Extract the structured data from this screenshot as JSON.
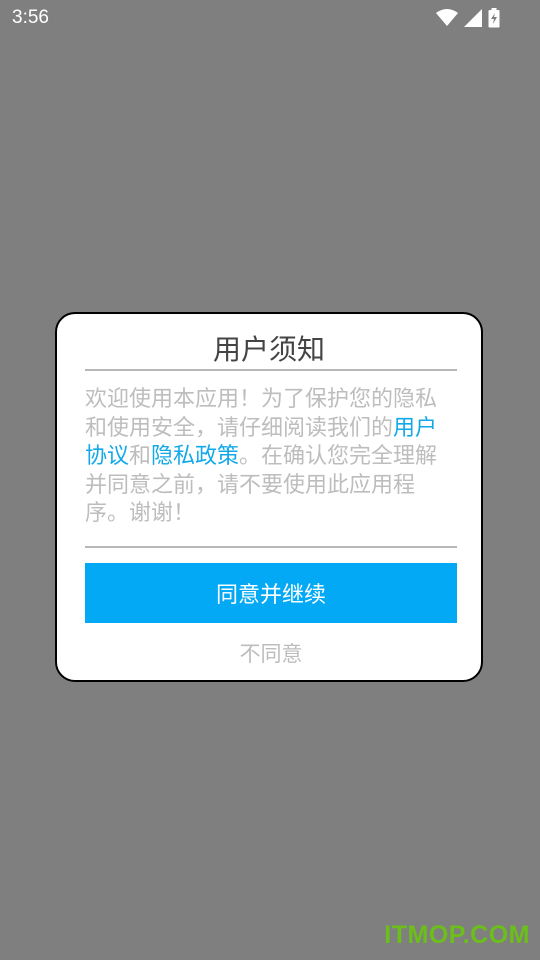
{
  "status_bar": {
    "time": "3:56",
    "icons": [
      "wifi-icon",
      "cell-signal-icon",
      "battery-charging-icon"
    ]
  },
  "dialog": {
    "title": "用户须知",
    "message": {
      "part1": "欢迎使用本应用！为了保护您的隐私和使用安全，请仔细阅读我们的",
      "link1": "用户协议",
      "part2": "和",
      "link2": "隐私政策",
      "part3": "。在确认您完全理解并同意之前，请不要使用此应用程序。谢谢！"
    },
    "agree_label": "同意并继续",
    "disagree_label": "不同意"
  },
  "watermark": "ITMOP.COM",
  "colors": {
    "overlay": "#7f7f7f",
    "accent": "#03a9f4",
    "link": "#13a9e9",
    "muted_text": "#bdbdbd",
    "watermark": "#6cbf1a"
  }
}
